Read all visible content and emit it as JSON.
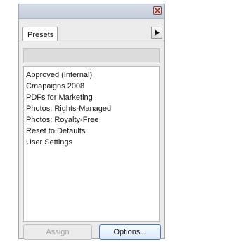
{
  "panel": {
    "tab_label": "Presets",
    "presets": [
      "Approved (Internal)",
      "Cmapaigns 2008",
      "PDFs for Marketing",
      "Photos: Rights-Managed",
      "Photos: Royalty-Free",
      "Reset to Defaults",
      "User Settings"
    ],
    "buttons": {
      "assign_label": "Assign",
      "options_label": "Options..."
    },
    "icons": {
      "close": "close-icon",
      "flyout": "triangle-right-icon"
    }
  }
}
